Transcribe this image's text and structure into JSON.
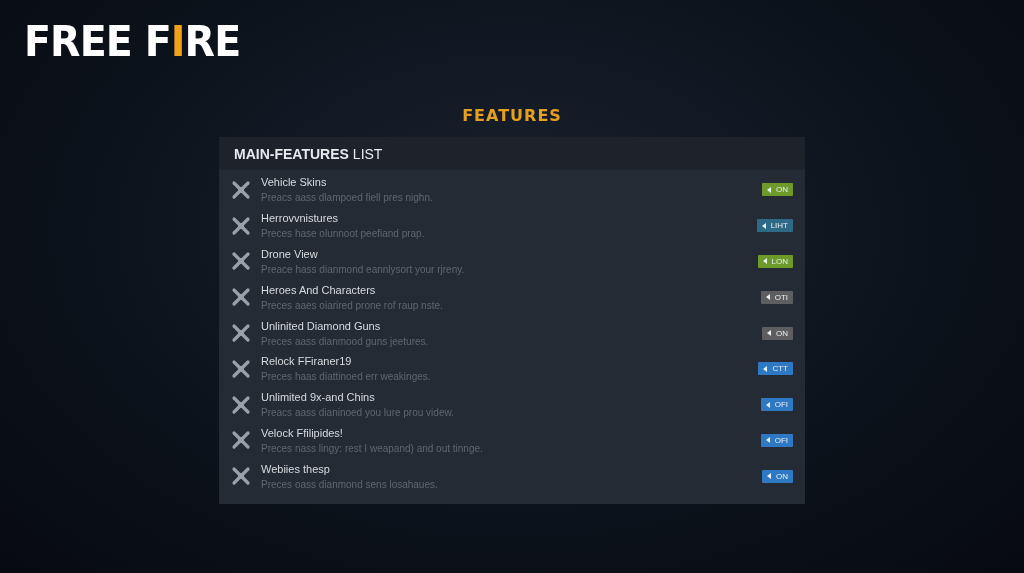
{
  "logo": {
    "parts": [
      "FREE F",
      "I",
      "RE"
    ]
  },
  "heading": "FEATURES",
  "panel": {
    "title_bold": "MAIN-FEATURES",
    "title_rest": "LIST",
    "features": [
      {
        "name": "Vehicle Skins",
        "description": "Preacs aass dlampoed fiell pres nighn.",
        "toggle": "ON",
        "color": "#6e9a2c"
      },
      {
        "name": "Herrovvnistures",
        "description": "Preces hase olunnoot peefiand prap.",
        "toggle": "LIHT",
        "color": "#2e6a86"
      },
      {
        "name": "Drone View",
        "description": "Preace hass dianmond eannlysort your rjreny.",
        "toggle": "LON",
        "color": "#6e9a2c"
      },
      {
        "name": "Heroes And Characters",
        "description": "Preces aaes oiarired prone rof raup nste.",
        "toggle": "OTI",
        "color": "#5e5e60"
      },
      {
        "name": "Unlinited Diamond Guns",
        "description": "Preces aass dianmood guns jeetures.",
        "toggle": "ON",
        "color": "#5e5e60"
      },
      {
        "name": "Relock FFiraner19",
        "description": "Preces haas diattinoed err weakinges.",
        "toggle": "CTT",
        "color": "#2f78c4"
      },
      {
        "name": "Unlimited 9x-and Chins",
        "description": "Preacs aass dianinoed you lure prou videw.",
        "toggle": "OFI",
        "color": "#2f78c4"
      },
      {
        "name": "Velock Ffilipides!",
        "description": "Preces nass lingy: rest I weapand) and out tinnge.",
        "toggle": "OFI",
        "color": "#2f78c4"
      },
      {
        "name": "Webiies thesp",
        "description": "Preces oass dianmond sens losahaues.",
        "toggle": "ON",
        "color": "#2f78c4"
      }
    ]
  }
}
